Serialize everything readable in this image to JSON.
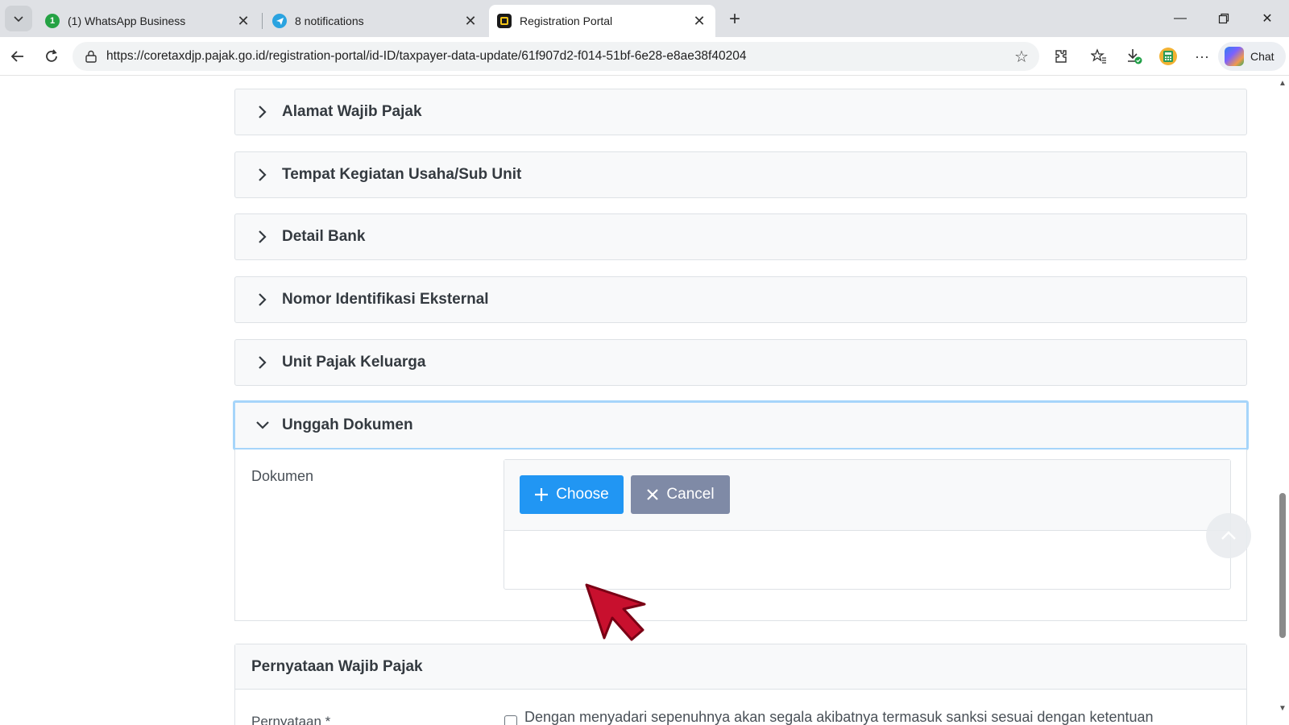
{
  "browser": {
    "tabs": [
      {
        "title": "(1) WhatsApp Business",
        "badge": "1"
      },
      {
        "title": "8 notifications"
      },
      {
        "title": "Registration Portal"
      }
    ],
    "url": "https://coretaxdjp.pajak.go.id/registration-portal/id-ID/taxpayer-data-update/61f907d2-f014-51bf-6e28-e8ae38f40204",
    "chat_label": "Chat"
  },
  "sections": [
    {
      "title": "Alamat Wajib Pajak",
      "expanded": false
    },
    {
      "title": "Tempat Kegiatan Usaha/Sub Unit",
      "expanded": false
    },
    {
      "title": "Detail Bank",
      "expanded": false
    },
    {
      "title": "Nomor Identifikasi Eksternal",
      "expanded": false
    },
    {
      "title": "Unit Pajak Keluarga",
      "expanded": false
    },
    {
      "title": "Unggah Dokumen",
      "expanded": true
    }
  ],
  "upload": {
    "label": "Dokumen",
    "choose_label": "Choose",
    "cancel_label": "Cancel"
  },
  "statement": {
    "title": "Pernyataan Wajib Pajak",
    "field_label": "Pernyataan *",
    "text": "Dengan menyadari sepenuhnya akan segala akibatnya termasuk sanksi sesuai dengan ketentuan"
  },
  "colors": {
    "primary": "#2196f3",
    "secondary": "#7f8aa6",
    "focus": "#a6d5fa",
    "cursor": "#c8102e"
  }
}
